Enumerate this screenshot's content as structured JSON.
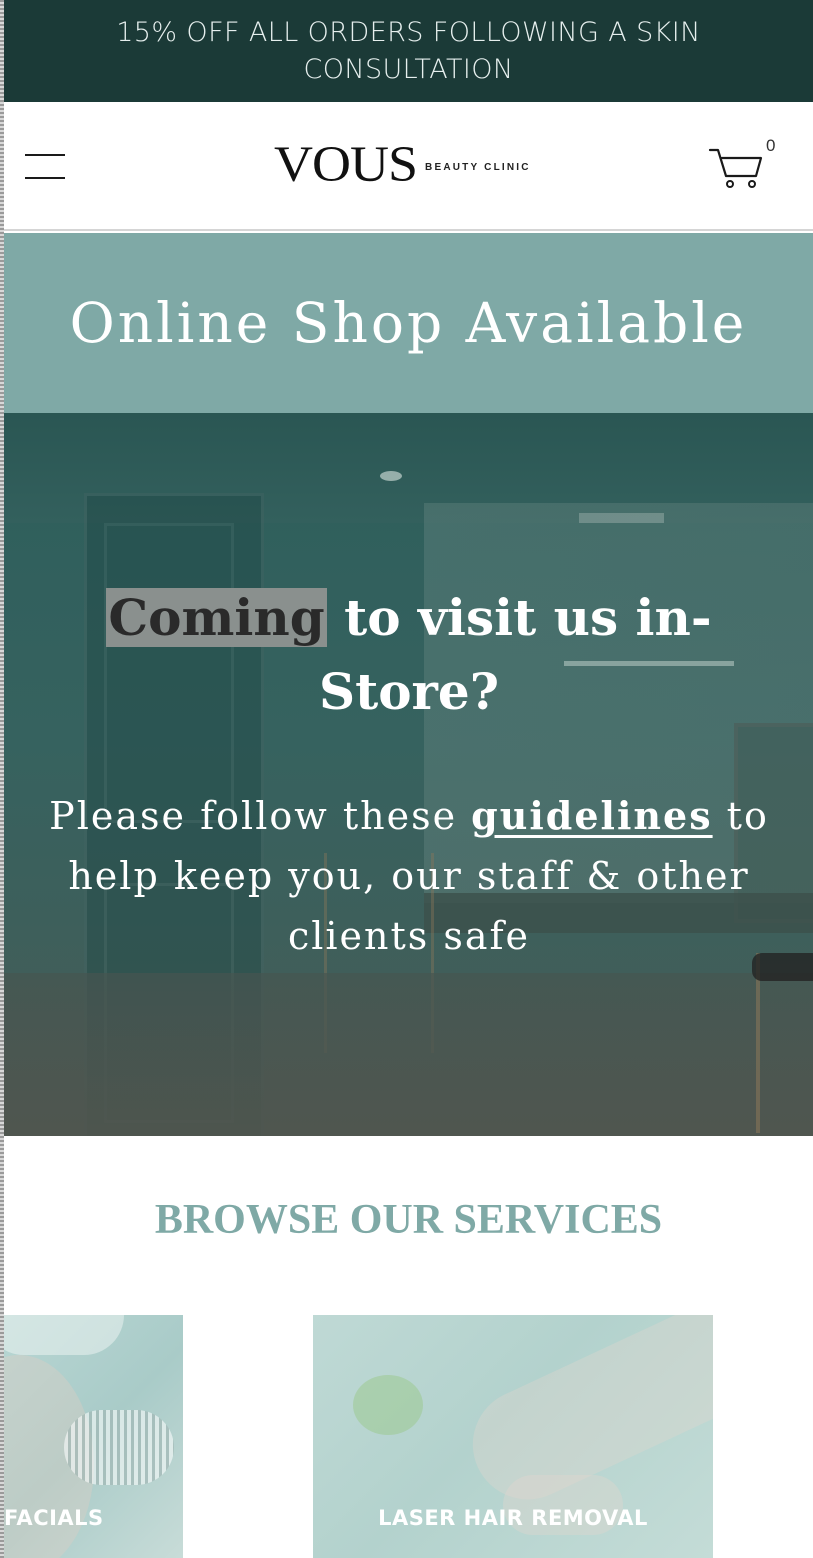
{
  "promo": {
    "text": "15% OFF ALL ORDERS FOLLOWING A SKIN CONSULTATION"
  },
  "header": {
    "logo_word": "VOUS",
    "logo_sub": "BEAUTY CLINIC",
    "cart_count": "0",
    "menu_icon": "hamburger-menu-icon",
    "cart_icon": "shopping-cart-icon"
  },
  "shop_banner": {
    "title": "Online Shop Available"
  },
  "hero": {
    "title_highlight": "Coming",
    "title_rest": " to visit us in-Store?",
    "text_before": "Please follow these ",
    "link_text": "guidelines",
    "text_after": " to help keep you, our staff & other clients safe"
  },
  "services": {
    "title": "BROWSE OUR SERVICES",
    "cards": [
      {
        "label": "FACIALS"
      },
      {
        "label": "LASER HAIR REMOVAL"
      }
    ]
  },
  "colors": {
    "promo_bg": "#1b3a37",
    "accent_teal": "#7fa9a6",
    "hero_overlay": "#2d5e5b"
  }
}
